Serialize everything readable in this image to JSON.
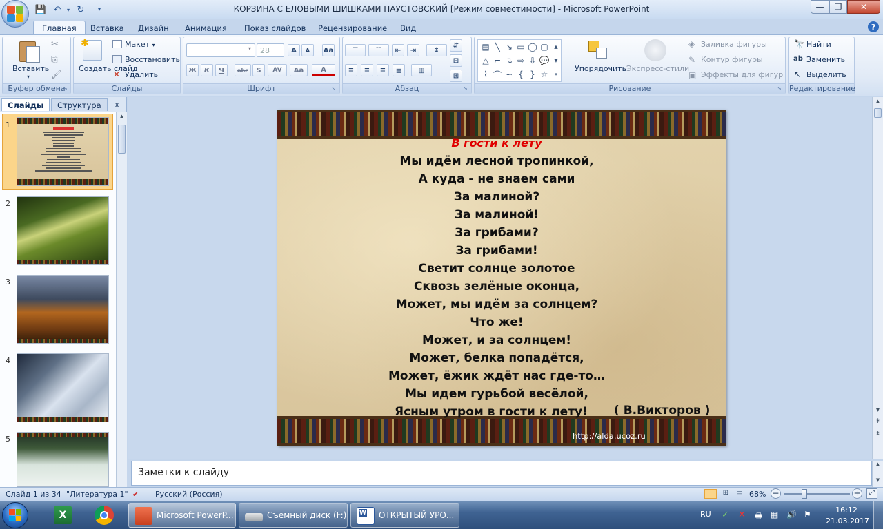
{
  "window": {
    "title": "КОРЗИНА С ЕЛОВЫМИ ШИШКАМИ ПАУСТОВСКИЙ [Режим совместимости] - Microsoft PowerPoint"
  },
  "tabs": [
    "Главная",
    "Вставка",
    "Дизайн",
    "Анимация",
    "Показ слайдов",
    "Рецензирование",
    "Вид"
  ],
  "ribbon": {
    "clipboard": {
      "label": "Буфер обмена",
      "paste": "Вставить"
    },
    "slides": {
      "label": "Слайды",
      "new_slide": "Создать слайд",
      "layout": "Макет",
      "reset": "Восстановить",
      "delete": "Удалить"
    },
    "font": {
      "label": "Шрифт",
      "font_name": "",
      "font_size": "28"
    },
    "paragraph": {
      "label": "Абзац"
    },
    "drawing": {
      "label": "Рисование",
      "arrange": "Упорядочить",
      "quick_styles": "Экспресс-стили",
      "fill": "Заливка фигуры",
      "outline": "Контур фигуры",
      "effects": "Эффекты для фигур"
    },
    "editing": {
      "label": "Редактирование",
      "find": "Найти",
      "replace": "Заменить",
      "select": "Выделить"
    }
  },
  "panel": {
    "tab_slides": "Слайды",
    "tab_outline": "Структура",
    "close": "x",
    "numbers": [
      "1",
      "2",
      "3",
      "4",
      "5"
    ]
  },
  "slide": {
    "title": "В гости к лету",
    "lines": [
      "Мы идём лесной тропинкой,",
      "А куда - не знаем сами",
      "За малиной?",
      "За малиной!",
      "За грибами?",
      "За грибами!",
      "Светит солнце золотое",
      "Сквозь зелёные оконца,",
      "Может, мы идём за солнцем?",
      "Что же!",
      "Может, и за солнцем!",
      "Может, белка попадётся,",
      "Может, ёжик ждёт нас где-то…",
      "Мы идем гурьбой весёлой,",
      "Ясным утром в гости к лету!"
    ],
    "author": "( В.Викторов )",
    "url": "http://alda.ucoz.ru"
  },
  "notes": {
    "placeholder": "Заметки к слайду"
  },
  "status": {
    "slide_info": "Слайд 1 из 34",
    "theme": "\"Литература 1\"",
    "language": "Русский (Россия)",
    "zoom": "68%"
  },
  "taskbar": {
    "items": [
      "Microsoft PowerP...",
      "Съемный диск (F:)",
      "ОТКРЫТЫЙ УРО..."
    ],
    "lang": "RU",
    "time": "16:12",
    "date": "21.03.2017"
  }
}
